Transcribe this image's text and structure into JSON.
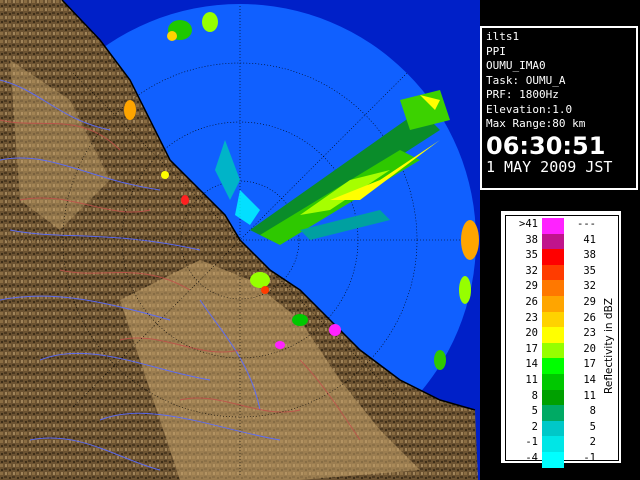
{
  "info": {
    "lines": [
      "ilts1",
      "PPI",
      "OUMU_IMA0",
      "Task: OUMU_A",
      "PRF: 1800Hz",
      "Elevation:1.0",
      "Max Range:80 km"
    ],
    "time": "06:30:51",
    "date": "1 MAY 2009 JST"
  },
  "legend": {
    "unit": "Reflectivity in dBZ",
    "rows": [
      {
        "lo": ">41",
        "hi": "---",
        "color": "#ff22ff"
      },
      {
        "lo": "38",
        "hi": "41",
        "color": "#c0148c"
      },
      {
        "lo": "35",
        "hi": "38",
        "color": "#ff0000"
      },
      {
        "lo": "32",
        "hi": "35",
        "color": "#ff3c00"
      },
      {
        "lo": "29",
        "hi": "32",
        "color": "#ff7800"
      },
      {
        "lo": "26",
        "hi": "29",
        "color": "#ffa500"
      },
      {
        "lo": "23",
        "hi": "26",
        "color": "#ffd200"
      },
      {
        "lo": "20",
        "hi": "23",
        "color": "#ffff00"
      },
      {
        "lo": "17",
        "hi": "20",
        "color": "#96ff00"
      },
      {
        "lo": "14",
        "hi": "17",
        "color": "#00ff00"
      },
      {
        "lo": "11",
        "hi": "14",
        "color": "#00c800"
      },
      {
        "lo": "8",
        "hi": "11",
        "color": "#00a000"
      },
      {
        "lo": "5",
        "hi": "8",
        "color": "#00aa64"
      },
      {
        "lo": "2",
        "hi": "5",
        "color": "#00c8c8"
      },
      {
        "lo": "-1",
        "hi": "2",
        "color": "#00e6e6"
      },
      {
        "lo": "-4",
        "hi": "-1",
        "color": "#00ffff"
      }
    ]
  },
  "colors": {
    "coverage": "#0a5aff",
    "outside": "#0020c8",
    "terrain": "#6e5534",
    "coast": "#000000"
  }
}
